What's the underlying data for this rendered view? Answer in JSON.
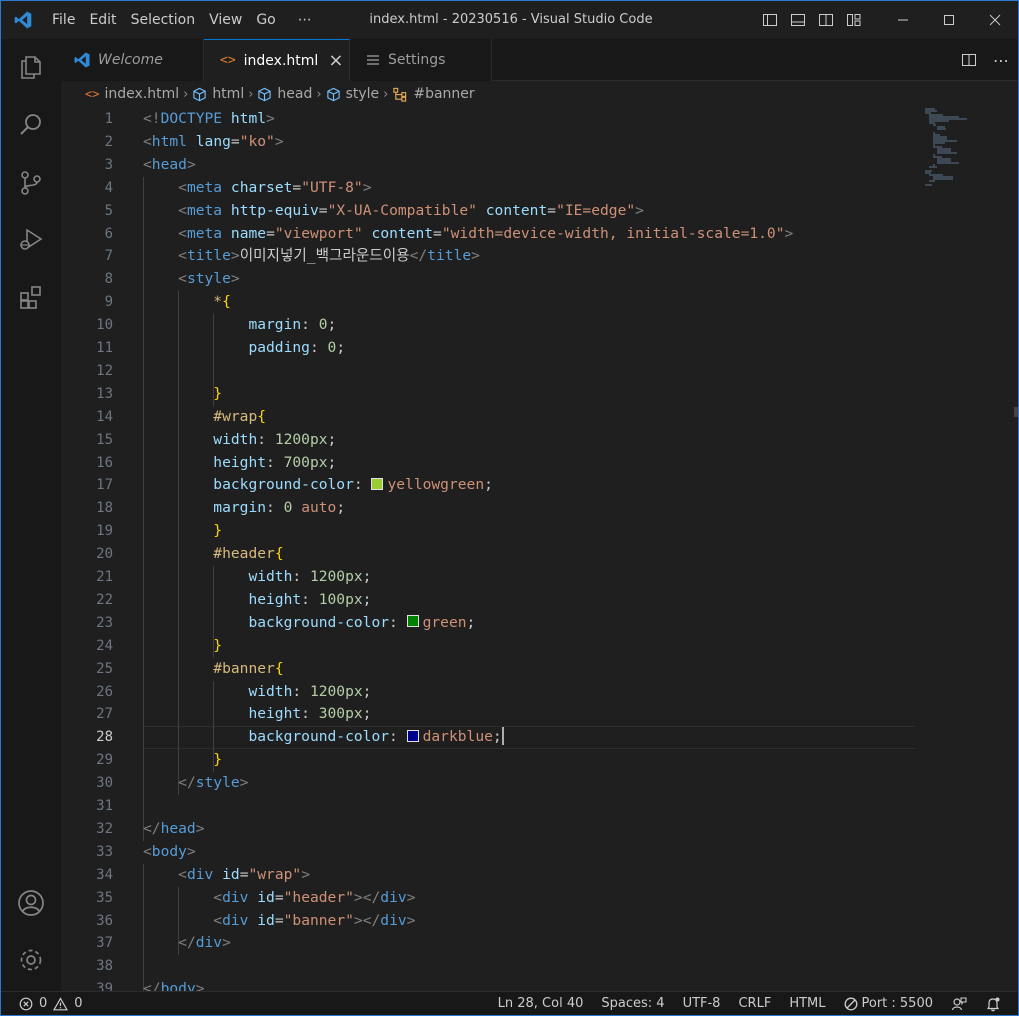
{
  "window": {
    "title": "index.html - 20230516 - Visual Studio Code",
    "menu": [
      "File",
      "Edit",
      "Selection",
      "View",
      "Go",
      "⋯"
    ]
  },
  "tabs": [
    {
      "label": "Welcome",
      "icon": "vscode-logo-icon",
      "active": false
    },
    {
      "label": "index.html",
      "icon": "html-file-icon",
      "active": true,
      "close": "×"
    },
    {
      "label": "Settings",
      "icon": "settings-list-icon",
      "active": false
    }
  ],
  "breadcrumbs": [
    "index.html",
    "html",
    "head",
    "style",
    "#banner"
  ],
  "editor": {
    "current_line": 28,
    "lines": [
      [
        [
          "p",
          "<!"
        ],
        [
          "dt",
          "DOCTYPE"
        ],
        [
          "tx",
          " "
        ],
        [
          "a",
          "html"
        ],
        [
          "p",
          ">"
        ]
      ],
      [
        [
          "p",
          "<"
        ],
        [
          "t",
          "html"
        ],
        [
          "tx",
          " "
        ],
        [
          "a",
          "lang"
        ],
        [
          "tx",
          "="
        ],
        [
          "s",
          "\"ko\""
        ],
        [
          "p",
          ">"
        ]
      ],
      [
        [
          "p",
          "<"
        ],
        [
          "t",
          "head"
        ],
        [
          "p",
          ">"
        ]
      ],
      [
        [
          "tx",
          "    "
        ],
        [
          "p",
          "<"
        ],
        [
          "t",
          "meta"
        ],
        [
          "tx",
          " "
        ],
        [
          "a",
          "charset"
        ],
        [
          "tx",
          "="
        ],
        [
          "s",
          "\"UTF-8\""
        ],
        [
          "p",
          ">"
        ]
      ],
      [
        [
          "tx",
          "    "
        ],
        [
          "p",
          "<"
        ],
        [
          "t",
          "meta"
        ],
        [
          "tx",
          " "
        ],
        [
          "a",
          "http-equiv"
        ],
        [
          "tx",
          "="
        ],
        [
          "s",
          "\"X-UA-Compatible\""
        ],
        [
          "tx",
          " "
        ],
        [
          "a",
          "content"
        ],
        [
          "tx",
          "="
        ],
        [
          "s",
          "\"IE=edge\""
        ],
        [
          "p",
          ">"
        ]
      ],
      [
        [
          "tx",
          "    "
        ],
        [
          "p",
          "<"
        ],
        [
          "t",
          "meta"
        ],
        [
          "tx",
          " "
        ],
        [
          "a",
          "name"
        ],
        [
          "tx",
          "="
        ],
        [
          "s",
          "\"viewport\""
        ],
        [
          "tx",
          " "
        ],
        [
          "a",
          "content"
        ],
        [
          "tx",
          "="
        ],
        [
          "s",
          "\"width=device-width, initial-scale=1.0\""
        ],
        [
          "p",
          ">"
        ]
      ],
      [
        [
          "tx",
          "    "
        ],
        [
          "p",
          "<"
        ],
        [
          "t",
          "title"
        ],
        [
          "p",
          ">"
        ],
        [
          "tx",
          "이미지넣기_백그라운드이용"
        ],
        [
          "p",
          "</"
        ],
        [
          "t",
          "title"
        ],
        [
          "p",
          ">"
        ]
      ],
      [
        [
          "tx",
          "    "
        ],
        [
          "p",
          "<"
        ],
        [
          "t",
          "style"
        ],
        [
          "p",
          ">"
        ]
      ],
      [
        [
          "tx",
          "        "
        ],
        [
          "c",
          "*"
        ],
        [
          "b",
          "{"
        ]
      ],
      [
        [
          "tx",
          "            "
        ],
        [
          "a",
          "margin"
        ],
        [
          "tx",
          ": "
        ],
        [
          "v",
          "0"
        ],
        [
          "tx",
          ";"
        ]
      ],
      [
        [
          "tx",
          "            "
        ],
        [
          "a",
          "padding"
        ],
        [
          "tx",
          ": "
        ],
        [
          "v",
          "0"
        ],
        [
          "tx",
          ";"
        ]
      ],
      [
        [
          "tx",
          ""
        ]
      ],
      [
        [
          "tx",
          "        "
        ],
        [
          "b",
          "}"
        ]
      ],
      [
        [
          "tx",
          "        "
        ],
        [
          "c",
          "#wrap"
        ],
        [
          "b",
          "{"
        ]
      ],
      [
        [
          "tx",
          "        "
        ],
        [
          "a",
          "width"
        ],
        [
          "tx",
          ": "
        ],
        [
          "v",
          "1200px"
        ],
        [
          "tx",
          ";"
        ]
      ],
      [
        [
          "tx",
          "        "
        ],
        [
          "a",
          "height"
        ],
        [
          "tx",
          ": "
        ],
        [
          "v",
          "700px"
        ],
        [
          "tx",
          ";"
        ]
      ],
      [
        [
          "tx",
          "        "
        ],
        [
          "a",
          "background-color"
        ],
        [
          "tx",
          ": "
        ],
        [
          "sw",
          "#9acd32"
        ],
        [
          "k",
          "yellowgreen"
        ],
        [
          "tx",
          ";"
        ]
      ],
      [
        [
          "tx",
          "        "
        ],
        [
          "a",
          "margin"
        ],
        [
          "tx",
          ": "
        ],
        [
          "v",
          "0"
        ],
        [
          "tx",
          " "
        ],
        [
          "k",
          "auto"
        ],
        [
          "tx",
          ";"
        ]
      ],
      [
        [
          "tx",
          "        "
        ],
        [
          "b",
          "}"
        ]
      ],
      [
        [
          "tx",
          "        "
        ],
        [
          "c",
          "#header"
        ],
        [
          "b",
          "{"
        ]
      ],
      [
        [
          "tx",
          "            "
        ],
        [
          "a",
          "width"
        ],
        [
          "tx",
          ": "
        ],
        [
          "v",
          "1200px"
        ],
        [
          "tx",
          ";"
        ]
      ],
      [
        [
          "tx",
          "            "
        ],
        [
          "a",
          "height"
        ],
        [
          "tx",
          ": "
        ],
        [
          "v",
          "100px"
        ],
        [
          "tx",
          ";"
        ]
      ],
      [
        [
          "tx",
          "            "
        ],
        [
          "a",
          "background-color"
        ],
        [
          "tx",
          ": "
        ],
        [
          "sw",
          "#008000"
        ],
        [
          "k",
          "green"
        ],
        [
          "tx",
          ";"
        ]
      ],
      [
        [
          "tx",
          "        "
        ],
        [
          "b",
          "}"
        ]
      ],
      [
        [
          "tx",
          "        "
        ],
        [
          "c",
          "#banner"
        ],
        [
          "b",
          "{"
        ]
      ],
      [
        [
          "tx",
          "            "
        ],
        [
          "a",
          "width"
        ],
        [
          "tx",
          ": "
        ],
        [
          "v",
          "1200px"
        ],
        [
          "tx",
          ";"
        ]
      ],
      [
        [
          "tx",
          "            "
        ],
        [
          "a",
          "height"
        ],
        [
          "tx",
          ": "
        ],
        [
          "v",
          "300px"
        ],
        [
          "tx",
          ";"
        ]
      ],
      [
        [
          "tx",
          "            "
        ],
        [
          "a",
          "background-color"
        ],
        [
          "tx",
          ": "
        ],
        [
          "sw",
          "#00008b"
        ],
        [
          "k",
          "darkblue"
        ],
        [
          "tx",
          ";"
        ],
        [
          "caret",
          ""
        ]
      ],
      [
        [
          "tx",
          "        "
        ],
        [
          "b",
          "}"
        ]
      ],
      [
        [
          "tx",
          "    "
        ],
        [
          "p",
          "</"
        ],
        [
          "t",
          "style"
        ],
        [
          "p",
          ">"
        ]
      ],
      [
        [
          "tx",
          ""
        ]
      ],
      [
        [
          "p",
          "</"
        ],
        [
          "t",
          "head"
        ],
        [
          "p",
          ">"
        ]
      ],
      [
        [
          "p",
          "<"
        ],
        [
          "t",
          "body"
        ],
        [
          "p",
          ">"
        ]
      ],
      [
        [
          "tx",
          "    "
        ],
        [
          "p",
          "<"
        ],
        [
          "t",
          "div"
        ],
        [
          "tx",
          " "
        ],
        [
          "a",
          "id"
        ],
        [
          "tx",
          "="
        ],
        [
          "s",
          "\"wrap\""
        ],
        [
          "p",
          ">"
        ]
      ],
      [
        [
          "tx",
          "        "
        ],
        [
          "p",
          "<"
        ],
        [
          "t",
          "div"
        ],
        [
          "tx",
          " "
        ],
        [
          "a",
          "id"
        ],
        [
          "tx",
          "="
        ],
        [
          "s",
          "\"header\""
        ],
        [
          "p",
          "></"
        ],
        [
          "t",
          "div"
        ],
        [
          "p",
          ">"
        ]
      ],
      [
        [
          "tx",
          "        "
        ],
        [
          "p",
          "<"
        ],
        [
          "t",
          "div"
        ],
        [
          "tx",
          " "
        ],
        [
          "a",
          "id"
        ],
        [
          "tx",
          "="
        ],
        [
          "s",
          "\"banner\""
        ],
        [
          "p",
          "></"
        ],
        [
          "t",
          "div"
        ],
        [
          "p",
          ">"
        ]
      ],
      [
        [
          "tx",
          "    "
        ],
        [
          "p",
          "</"
        ],
        [
          "t",
          "div"
        ],
        [
          "p",
          ">"
        ]
      ],
      [
        [
          "tx",
          ""
        ]
      ],
      [
        [
          "p",
          "</"
        ],
        [
          "t",
          "body"
        ],
        [
          "p",
          ">"
        ]
      ]
    ]
  },
  "statusbar": {
    "errors": "0",
    "warnings": "0",
    "position": "Ln 28, Col 40",
    "spaces": "Spaces: 4",
    "encoding": "UTF-8",
    "eol": "CRLF",
    "language": "HTML",
    "port": "Port : 5500"
  },
  "colors": {
    "accent": "#0078d4",
    "editor_bg": "#1f1f1f",
    "sidebar_bg": "#181818"
  }
}
